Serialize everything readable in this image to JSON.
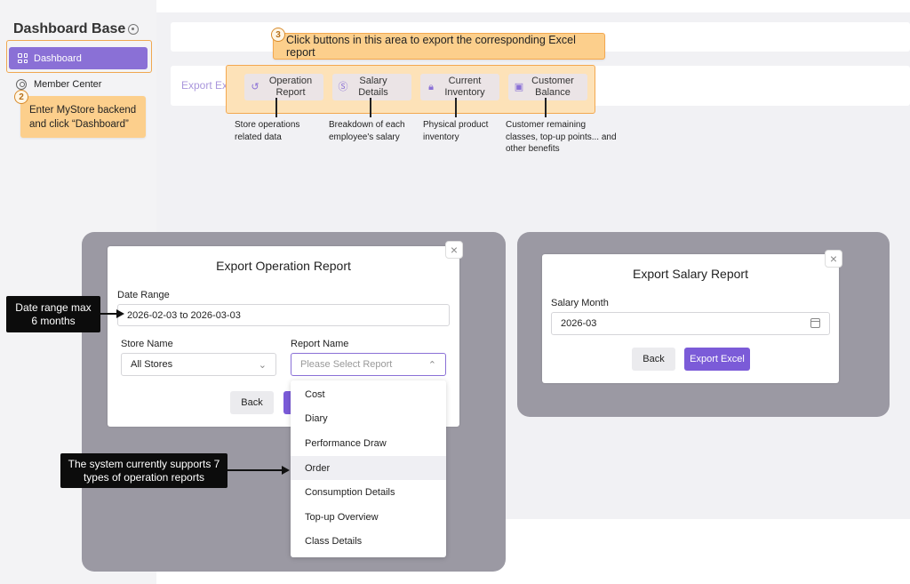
{
  "sidebar": {
    "brand": "Dashboard Base",
    "items": [
      {
        "label": "Dashboard",
        "icon": "grid-icon"
      },
      {
        "label": "Member Center",
        "icon": "user-icon"
      }
    ]
  },
  "callouts": {
    "step2": {
      "num": "2",
      "text": "Enter MyStore backend and click “Dashboard”"
    },
    "step3": {
      "num": "3",
      "text": "Click buttons in this area to export the corresponding Excel report"
    },
    "date_tip": "Date range max 6 months",
    "types_tip": "The system currently supports 7 types of operation reports"
  },
  "export_bar": {
    "label": "Export Excel",
    "buttons": [
      {
        "label": "Operation Report",
        "icon": "history-icon",
        "desc": "Store operations related data"
      },
      {
        "label": "Salary Details",
        "icon": "dollar-icon",
        "desc": "Breakdown of each employee's salary"
      },
      {
        "label": "Current Inventory",
        "icon": "lock-icon",
        "desc": "Physical product inventory"
      },
      {
        "label": "Customer Balance",
        "icon": "wallet-icon",
        "desc": "Customer remaining classes, top-up points... and other benefits"
      }
    ]
  },
  "operation_modal": {
    "title": "Export Operation Report",
    "date_label": "Date Range",
    "date_value": "2026-02-03 to 2026-03-03",
    "store_label": "Store Name",
    "store_value": "All Stores",
    "report_label": "Report Name",
    "report_placeholder": "Please Select Report",
    "back": "Back",
    "close": "×",
    "options": [
      "Cost",
      "Diary",
      "Performance Draw",
      "Order",
      "Consumption Details",
      "Top-up Overview",
      "Class Details"
    ],
    "highlighted_option": "Order"
  },
  "salary_modal": {
    "title": "Export Salary Report",
    "month_label": "Salary Month",
    "month_value": "2026-03",
    "back": "Back",
    "export": "Export Excel",
    "close": "×"
  },
  "colors": {
    "accent": "#7b5bd8",
    "callout": "#fccf8c",
    "callout_border": "#f3a850",
    "panel": "#9b99a3"
  }
}
